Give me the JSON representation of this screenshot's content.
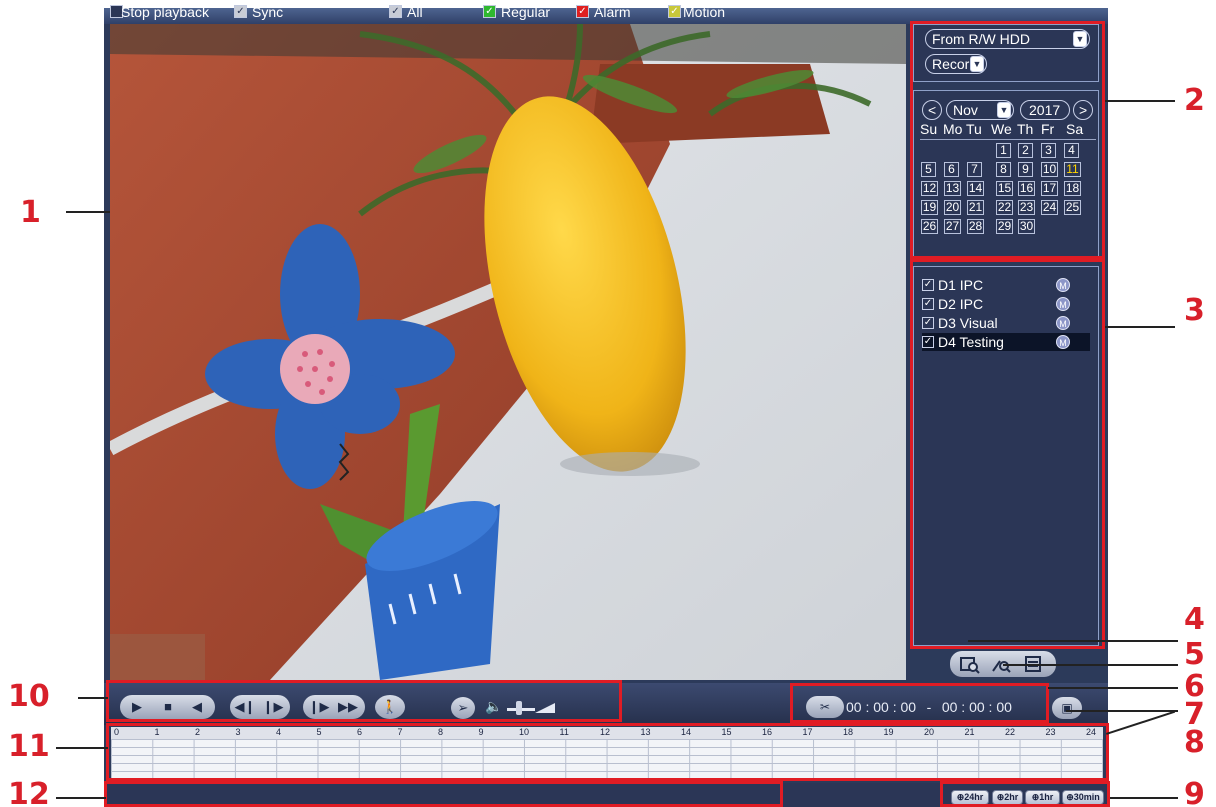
{
  "source_panel": {
    "source_value": "From R/W HDD",
    "type_value": "Recor"
  },
  "calendar": {
    "prev_label": "<",
    "next_label": ">",
    "month": "Nov",
    "year": "2017",
    "weekdays": [
      "Su",
      "Mo",
      "Tu",
      "We",
      "Th",
      "Fr",
      "Sa"
    ],
    "weeks": [
      [
        "",
        "",
        "",
        "1",
        "2",
        "3",
        "4"
      ],
      [
        "5",
        "6",
        "7",
        "8",
        "9",
        "10",
        "11"
      ],
      [
        "12",
        "13",
        "14",
        "15",
        "16",
        "17",
        "18"
      ],
      [
        "19",
        "20",
        "21",
        "22",
        "23",
        "24",
        "25"
      ],
      [
        "26",
        "27",
        "28",
        "29",
        "30",
        "",
        ""
      ]
    ],
    "highlighted_day": "11"
  },
  "channels": [
    {
      "name": "D1 IPC",
      "badge": "M"
    },
    {
      "name": "D2 IPC",
      "badge": "M"
    },
    {
      "name": "D3 Visual",
      "badge": "M"
    },
    {
      "name": "D4 Testing",
      "badge": "M"
    }
  ],
  "clip_times": {
    "start": "00 : 00 : 00",
    "separator": "-",
    "end": "00 : 00 : 00"
  },
  "timeline": {
    "hours": [
      "0",
      "1",
      "2",
      "3",
      "4",
      "5",
      "6",
      "7",
      "8",
      "9",
      "10",
      "11",
      "12",
      "13",
      "14",
      "15",
      "16",
      "17",
      "18",
      "19",
      "20",
      "21",
      "22",
      "23",
      "24"
    ]
  },
  "bottom_bar": {
    "stop_label": "Stop playback",
    "sync_label": "Sync",
    "all_label": "All",
    "regular_label": "Regular",
    "alarm_label": "Alarm",
    "motion_label": "Motion"
  },
  "zoom_buttons": [
    "24hr",
    "2hr",
    "1hr",
    "30min"
  ],
  "callouts": [
    "1",
    "2",
    "3",
    "4",
    "5",
    "6",
    "7",
    "8",
    "9",
    "10",
    "11",
    "12"
  ],
  "colors": {
    "annotation_red": "#e01c24",
    "regular": "#2fb82f",
    "alarm": "#e02020",
    "motion": "#c8c83a",
    "today": "#ffd400"
  },
  "icons": {
    "play": "play-icon",
    "stop": "stop-icon",
    "reverse": "reverse-play-icon",
    "slow": "slow-play-icon",
    "fast": "fast-forward-icon",
    "smart": "smart-search-icon",
    "mark": "mark-icon",
    "volume": "volume-icon"
  }
}
